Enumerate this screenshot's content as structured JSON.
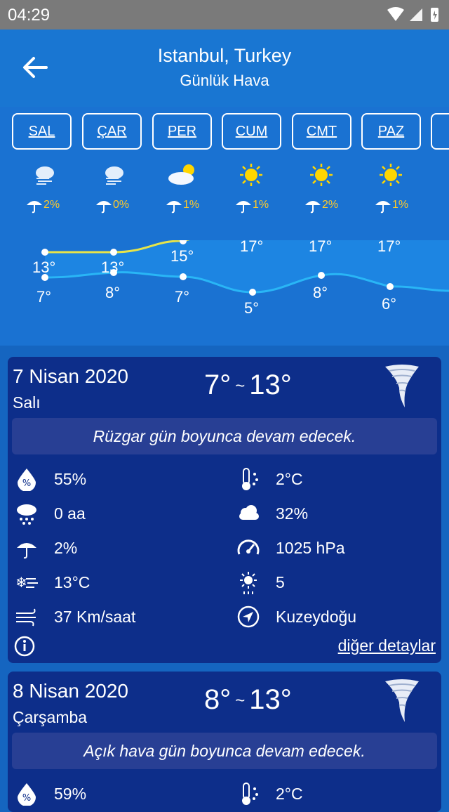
{
  "status": {
    "time": "04:29"
  },
  "header": {
    "title": "Istanbul, Turkey",
    "subtitle": "Günlük Hava"
  },
  "days": [
    {
      "label": "SAL",
      "icon": "wind-rain-icon",
      "rain": "2%",
      "high": "13°",
      "low": "7°"
    },
    {
      "label": "ÇAR",
      "icon": "wind-rain-icon",
      "rain": "0%",
      "high": "13°",
      "low": "8°"
    },
    {
      "label": "PER",
      "icon": "partly-cloudy-icon",
      "rain": "1%",
      "high": "15°",
      "low": "7°"
    },
    {
      "label": "CUM",
      "icon": "sun-icon",
      "rain": "1%",
      "high": "17°",
      "low": "5°"
    },
    {
      "label": "CMT",
      "icon": "sun-icon",
      "rain": "2%",
      "high": "17°",
      "low": "8°"
    },
    {
      "label": "PAZ",
      "icon": "sun-icon",
      "rain": "1%",
      "high": "17°",
      "low": "6°"
    }
  ],
  "cards": [
    {
      "date": "7 Nisan 2020",
      "weekday": "Salı",
      "low": "7°",
      "high": "13°",
      "sep": "~",
      "summary": "Rüzgar gün boyunca devam edecek.",
      "humidity": "55%",
      "dew_point": "2°C",
      "precip": "0 aa",
      "cloud": "32%",
      "rain_chance": "2%",
      "pressure": "1025 hPa",
      "feels_like": "13°C",
      "uv": "5",
      "wind_speed": "37 Km/saat",
      "wind_dir": "Kuzeydoğu",
      "more": "diğer detaylar"
    },
    {
      "date": "8 Nisan 2020",
      "weekday": "Çarşamba",
      "low": "8°",
      "high": "13°",
      "sep": "~",
      "summary": "Açık hava gün boyunca devam edecek.",
      "humidity": "59%",
      "dew_point": "2°C"
    }
  ],
  "colors": {
    "high_line": "#e6e44a",
    "low_line": "#29b6f6",
    "card_bg": "#0d2e8a",
    "accent_rain": "#ffca28"
  }
}
